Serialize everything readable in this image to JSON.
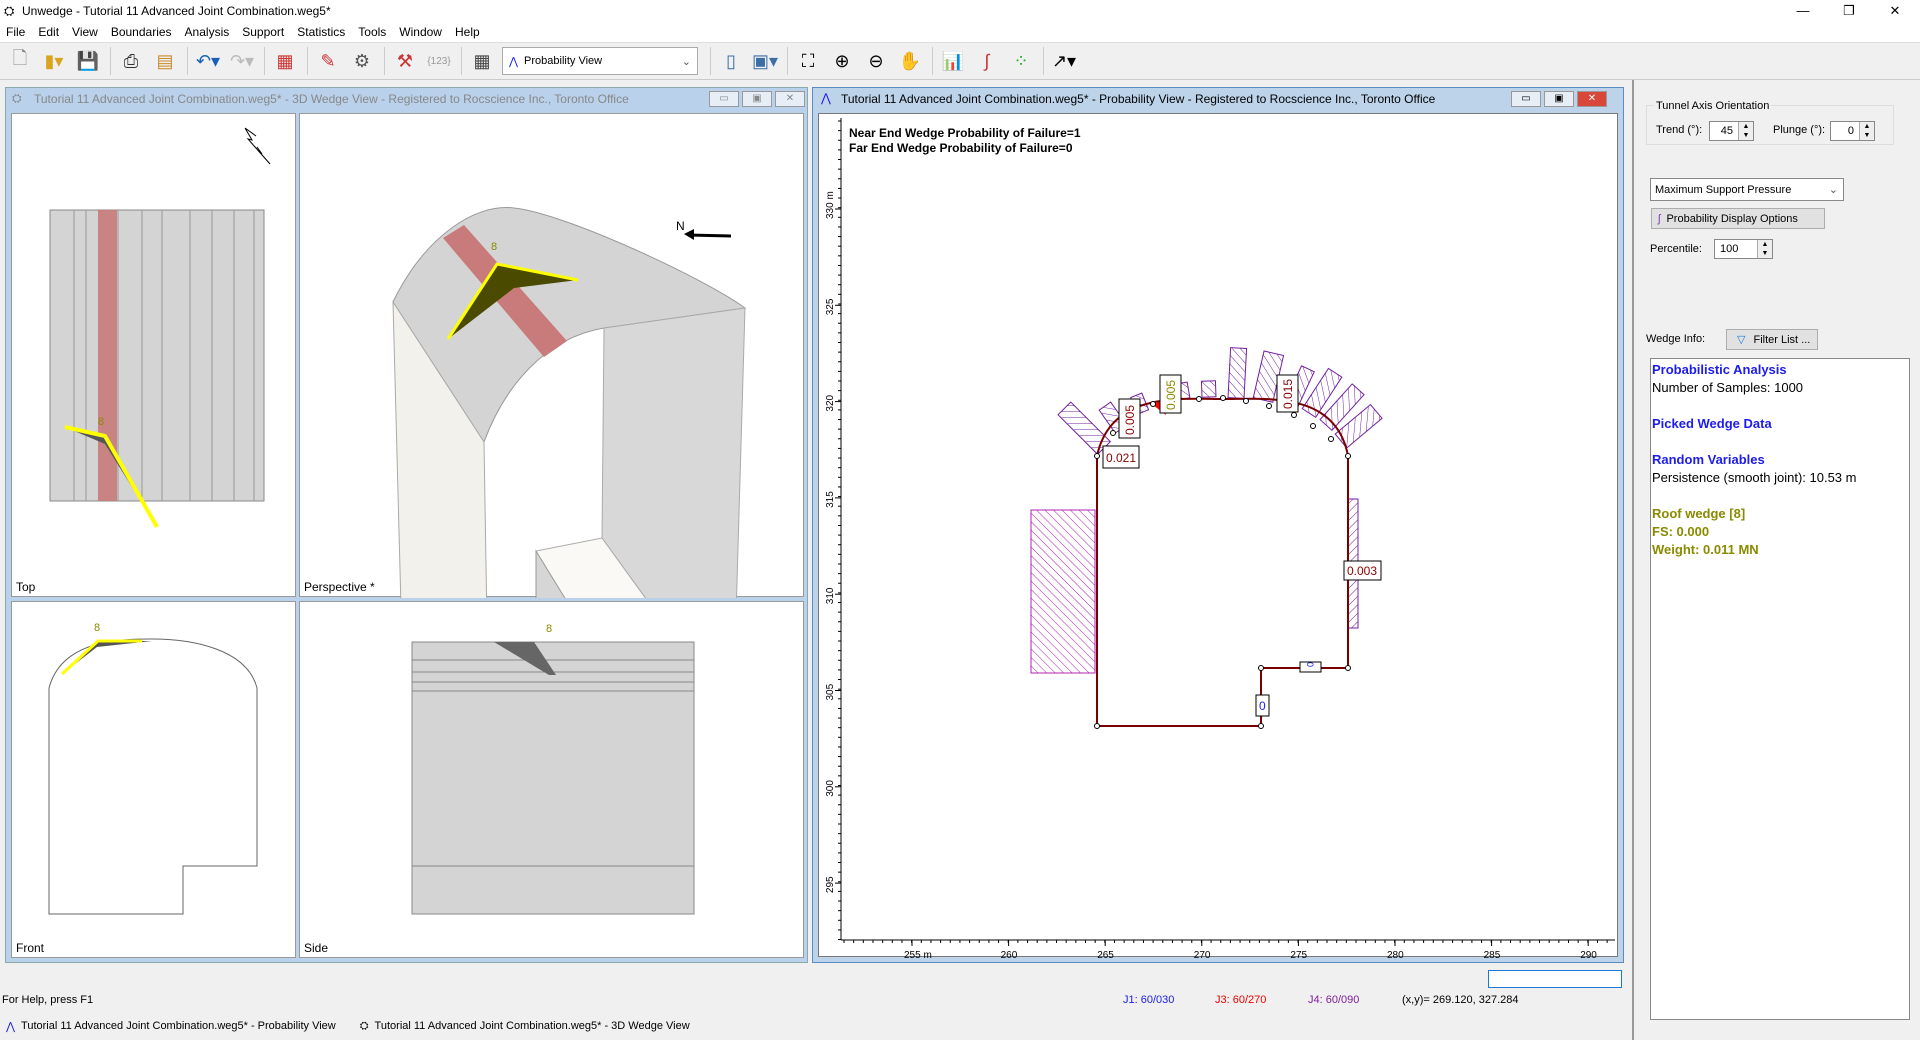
{
  "app": {
    "title": "Unwedge - Tutorial 11 Advanced Joint Combination.weg5*"
  },
  "menu": [
    "File",
    "Edit",
    "View",
    "Boundaries",
    "Analysis",
    "Support",
    "Statistics",
    "Tools",
    "Window",
    "Help"
  ],
  "toolbar": {
    "view_select": "Probability View"
  },
  "wedge_window": {
    "title": "Tutorial 11 Advanced Joint Combination.weg5* - 3D Wedge View - Registered to Rocscience Inc., Toronto Office",
    "views": {
      "top": "Top",
      "perspective": "Perspective *",
      "front": "Front",
      "side": "Side"
    },
    "wedge_id": "8",
    "north": "N"
  },
  "prob_window": {
    "title": "Tutorial 11 Advanced Joint Combination.weg5* - Probability View - Registered to Rocscience Inc., Toronto Office",
    "near_end": "Near End Wedge Probability of Failure=1",
    "far_end": "Far End Wedge Probability of Failure=0",
    "labels": {
      "l1": "0.021",
      "l2": "0.005",
      "l3": "0.005",
      "l4": "0.015",
      "l5": "0.003",
      "l6": "0",
      "l7": "0"
    },
    "x_ticks": [
      "255 m",
      "260",
      "265",
      "270",
      "275",
      "280",
      "285",
      "290"
    ],
    "y_ticks": [
      "330 m",
      "325",
      "320",
      "315",
      "310",
      "305",
      "300",
      "295"
    ],
    "colors": {
      "outline": "#7a0000",
      "hatch": "#7020a0",
      "left_hatch": "#b020b0",
      "failed": "#ff0000"
    }
  },
  "panel": {
    "group": "Tunnel Axis Orientation",
    "trend_label": "Trend (°):",
    "trend": "45",
    "plunge_label": "Plunge (°):",
    "plunge": "0",
    "display_select": "Maximum Support Pressure",
    "display_options": "Probability Display Options",
    "percentile_label": "Percentile:",
    "percentile": "100",
    "wedge_info_label": "Wedge Info:",
    "filter": "Filter List ...",
    "info": {
      "h1": "Probabilistic Analysis",
      "samples": "Number of Samples: 1000",
      "h2": "Picked Wedge Data",
      "h3": "Random Variables",
      "persistence": "Persistence (smooth joint): 10.53 m",
      "wedge": "Roof wedge [8]",
      "fs": "FS: 0.000",
      "weight": "Weight: 0.011 MN"
    }
  },
  "status": {
    "help": "For Help, press F1",
    "j1": "J1: 60/030",
    "j3": "J3: 60/270",
    "j4": "J4: 60/090",
    "coords": "(x,y)= 269.120, 327.284"
  },
  "taskbar": [
    "Tutorial 11 Advanced Joint Combination.weg5* - Probability View",
    "Tutorial 11 Advanced Joint Combination.weg5* - 3D Wedge View"
  ]
}
